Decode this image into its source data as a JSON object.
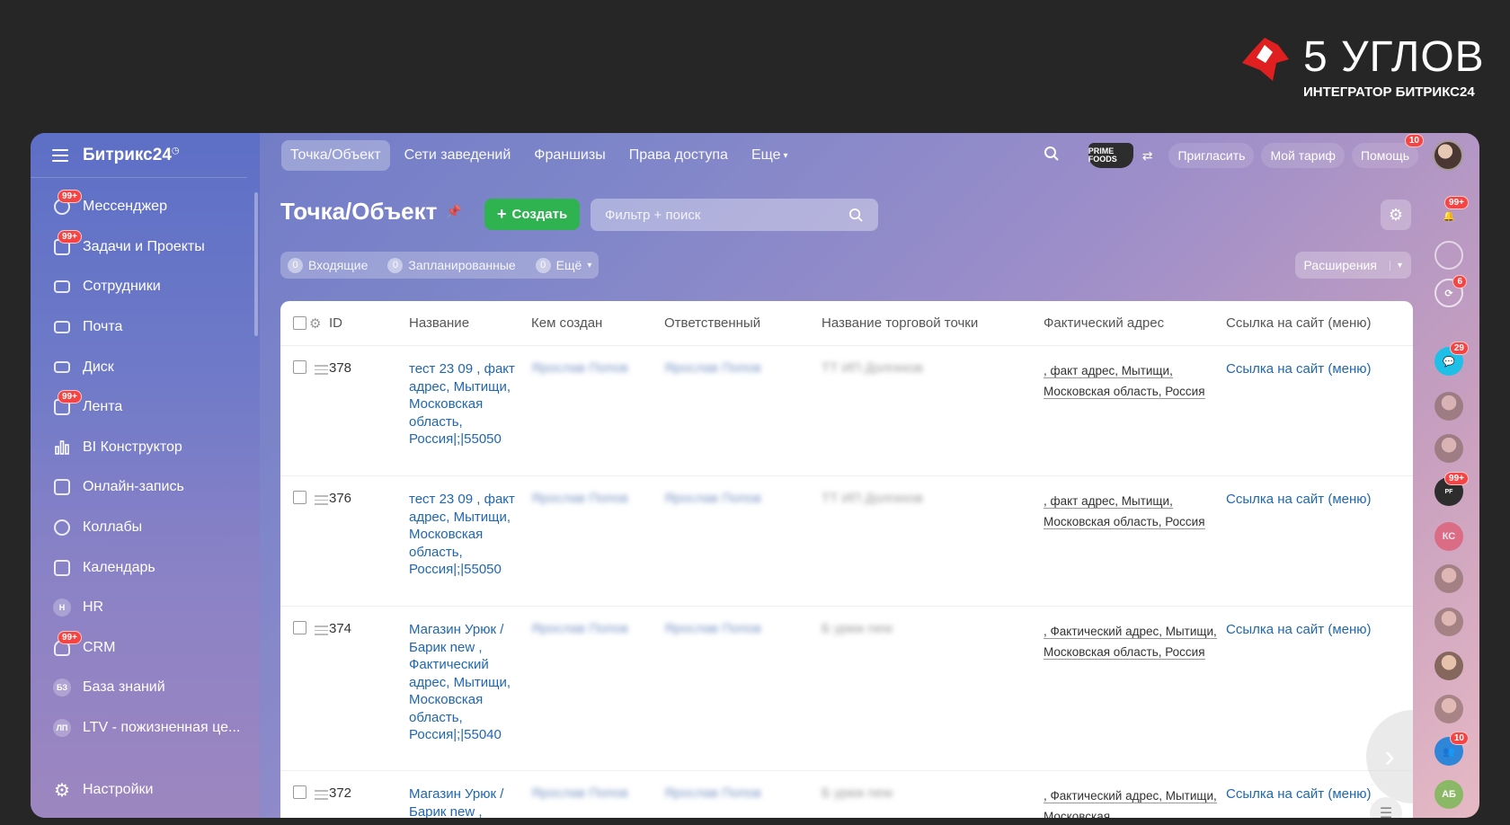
{
  "brand": {
    "title": "5 УГЛОВ",
    "subtitle": "ИНТЕГРАТОР БИТРИКС24"
  },
  "sidebar": {
    "title": "Битрикс24",
    "items": [
      {
        "label": "Мессенджер",
        "icon": "chat-icon",
        "badge": "99+"
      },
      {
        "label": "Задачи и Проекты",
        "icon": "tasks-icon",
        "badge": "99+"
      },
      {
        "label": "Сотрудники",
        "icon": "employees-icon"
      },
      {
        "label": "Почта",
        "icon": "mail-icon"
      },
      {
        "label": "Диск",
        "icon": "disk-icon"
      },
      {
        "label": "Лента",
        "icon": "feed-icon",
        "badge": "99+"
      },
      {
        "label": "BI Конструктор",
        "icon": "bi-chart-icon"
      },
      {
        "label": "Онлайн-запись",
        "icon": "booking-icon"
      },
      {
        "label": "Коллабы",
        "icon": "collab-icon"
      },
      {
        "label": "Календарь",
        "icon": "calendar-icon"
      },
      {
        "label": "HR",
        "icon": "hr-icon",
        "abbr": "Н"
      },
      {
        "label": "CRM",
        "icon": "crm-icon",
        "badge": "99+"
      },
      {
        "label": "База знаний",
        "icon": "knowledge-icon",
        "abbr": "БЗ"
      },
      {
        "label": "LTV - пожизненная це...",
        "icon": "ltv-icon",
        "abbr": "ЛП"
      }
    ],
    "settings": "Настройки"
  },
  "topbar": {
    "tabs": [
      "Точка/Объект",
      "Сети заведений",
      "Франшизы",
      "Права доступа"
    ],
    "more": "Еще",
    "invite": "Пригласить",
    "tariff": "Мой тариф",
    "help": "Помощь",
    "help_badge": "10",
    "prime_logo": "PRIME FOODS"
  },
  "page": {
    "title": "Точка/Объект",
    "create_label": "Создать",
    "search_placeholder": "Фильтр + поиск",
    "counters": [
      {
        "count": "0",
        "label": "Входящие"
      },
      {
        "count": "0",
        "label": "Запланированные"
      },
      {
        "count": "0",
        "label": "Ещё"
      }
    ],
    "extensions": "Расширения"
  },
  "table": {
    "columns": [
      "ID",
      "Название",
      "Кем создан",
      "Ответственный",
      "Название торговой точки",
      "Фактический адрес",
      "Ссылка на сайт (меню)"
    ],
    "rows": [
      {
        "id": "378",
        "name": "тест 23 09 , факт адрес, Мытищи, Московская область, Россия|;|55050",
        "created_by": "Ярослав Попов",
        "responsible": "Ярослав Попов",
        "shop": "ТТ ИП Долгихов",
        "address": ", факт адрес, Мытищи, Московская область, Россия",
        "link": "Ссылка на сайт (меню)"
      },
      {
        "id": "376",
        "name": "тест 23 09 , факт адрес, Мытищи, Московская область, Россия|;|55050",
        "created_by": "Ярослав Попов",
        "responsible": "Ярослав Попов",
        "shop": "ТТ ИП Долгихов",
        "address": ", факт адрес, Мытищи, Московская область, Россия",
        "link": "Ссылка на сайт (меню)"
      },
      {
        "id": "374",
        "name": "Магазин Урюк / Барик new , Фактический адрес, Мытищи, Московская область, Россия|;|55040",
        "created_by": "Ярослав Попов",
        "responsible": "Ярослав Попов",
        "shop": "Б урюк new",
        "address": ", Фактический адрес, Мытищи, Московская область, Россия",
        "link": "Ссылка на сайт (меню)"
      },
      {
        "id": "372",
        "name": "Магазин Урюк / Барик new ,",
        "created_by": "Ярослав Попов",
        "responsible": "Ярослав Попов",
        "shop": "Б урюк new",
        "address": ", Фактический адрес, Мытищи, Московская",
        "link": "Ссылка на сайт (меню)"
      }
    ]
  },
  "rail": {
    "notifications_badge": "99+",
    "sync_badge": "6",
    "chat_badge": "29",
    "prime_badge": "99+",
    "ks_initials": "КС",
    "group_badge": "10",
    "ab_initials": "АБ"
  },
  "colors": {
    "accent_green": "#2fb250",
    "link_blue": "#2067b0",
    "badge_red": "#f44444"
  }
}
